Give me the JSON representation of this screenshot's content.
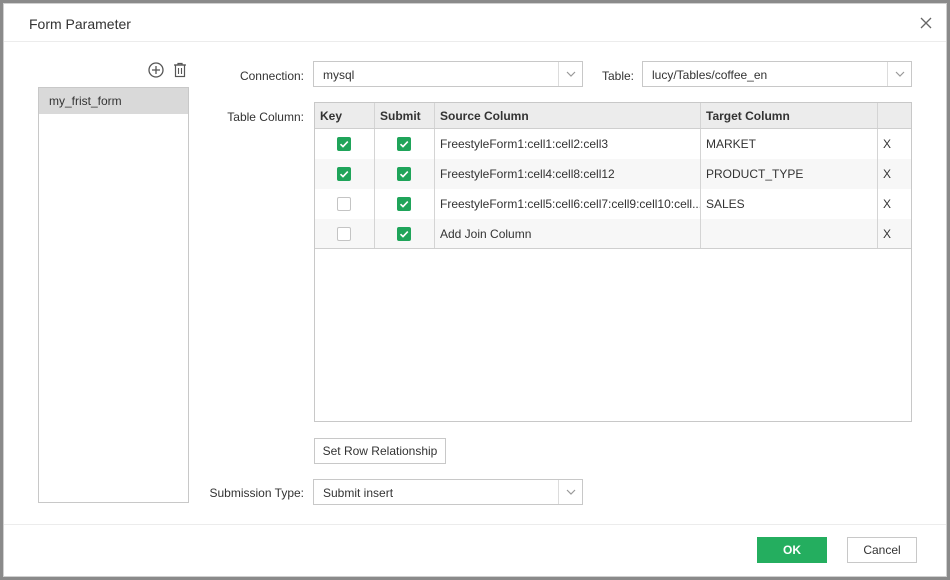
{
  "dialog": {
    "title": "Form Parameter",
    "close_label": "close"
  },
  "forms": {
    "items": [
      "my_frist_form"
    ]
  },
  "connection": {
    "label": "Connection:",
    "value": "mysql"
  },
  "table": {
    "label": "Table:",
    "value": "lucy/Tables/coffee_en"
  },
  "table_column": {
    "label": "Table Column:",
    "headers": {
      "key": "Key",
      "submit": "Submit",
      "source": "Source Column",
      "target": "Target Column"
    },
    "rows": [
      {
        "key": true,
        "submit": true,
        "source": "FreestyleForm1:cell1:cell2:cell3",
        "target": "MARKET",
        "delete": "X"
      },
      {
        "key": true,
        "submit": true,
        "source": "FreestyleForm1:cell4:cell8:cell12",
        "target": "PRODUCT_TYPE",
        "delete": "X"
      },
      {
        "key": false,
        "submit": true,
        "source": "FreestyleForm1:cell5:cell6:cell7:cell9:cell10:cell...",
        "target": "SALES",
        "delete": "X"
      },
      {
        "key": false,
        "submit": true,
        "source": "Add Join Column",
        "target": "",
        "delete": "X"
      }
    ]
  },
  "set_row_relationship": "Set Row Relationship",
  "submission_type": {
    "label": "Submission Type:",
    "value": "Submit insert"
  },
  "footer": {
    "ok": "OK",
    "cancel": "Cancel"
  },
  "colors": {
    "accent": "#24ae5f",
    "checkbox_checked": "#1fa45a"
  },
  "icons": {
    "add": "add-circle-icon",
    "delete": "trash-icon",
    "close": "close-icon",
    "dropdown": "chevron-down-icon",
    "check": "checkmark-icon"
  }
}
